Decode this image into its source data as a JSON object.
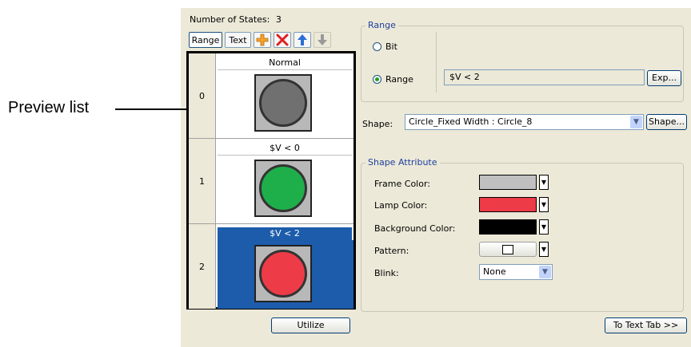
{
  "callout": {
    "label": "Preview list"
  },
  "states": {
    "label": "Number of States:",
    "count": "3"
  },
  "toolbar": {
    "range_label": "Range",
    "text_label": "Text"
  },
  "preview_rows": [
    {
      "index": "0",
      "label": "Normal",
      "lamp_color": "#707070"
    },
    {
      "index": "1",
      "label": "$V < 0",
      "lamp_color": "#1EAF4B"
    },
    {
      "index": "2",
      "label": "$V < 2",
      "lamp_color": "#EE3B48"
    }
  ],
  "range_group": {
    "title": "Range",
    "bit_label": "Bit",
    "range_label": "Range",
    "range_value": "$V < 2",
    "exp_button": "Exp..."
  },
  "shape": {
    "label": "Shape:",
    "value": "Circle_Fixed Width : Circle_8",
    "button": "Shape..."
  },
  "shape_attribute": {
    "title": "Shape Attribute",
    "frame_color_label": "Frame Color:",
    "lamp_color_label": "Lamp Color:",
    "background_color_label": "Background Color:",
    "pattern_label": "Pattern:",
    "blink_label": "Blink:",
    "blink_value": "None",
    "frame_color": "#C0C0C0",
    "lamp_color": "#EE3B48",
    "background_color": "#000000"
  },
  "buttons": {
    "utilize": "Utilize",
    "to_text_tab": "To Text Tab >>"
  }
}
